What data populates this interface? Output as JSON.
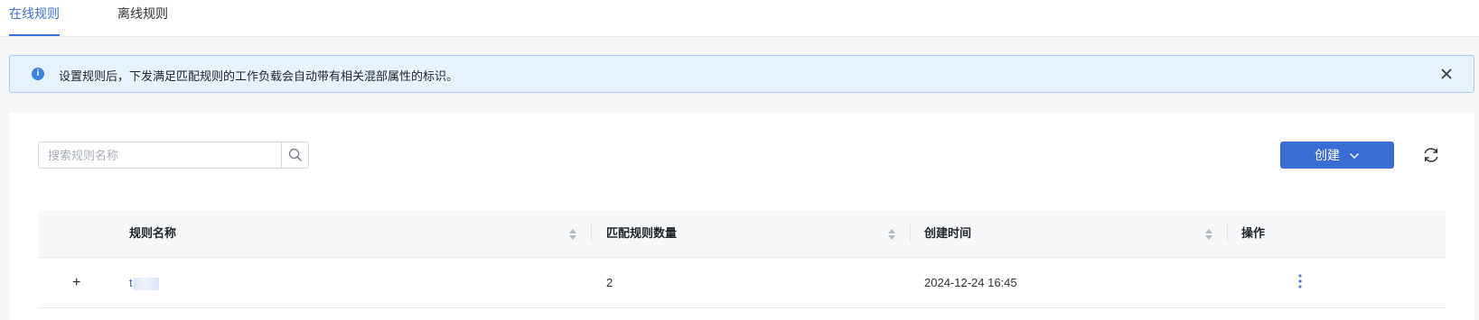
{
  "tabs": [
    {
      "label": "在线规则",
      "active": true
    },
    {
      "label": "离线规则",
      "active": false
    }
  ],
  "alert": {
    "message": "设置规则后，下发满足匹配规则的工作负载会自动带有相关混部属性的标识。",
    "icon": "info-icon"
  },
  "toolbar": {
    "search_placeholder": "搜索规则名称",
    "search_value": "",
    "create_label": "创建",
    "refresh_icon": "refresh-icon"
  },
  "table": {
    "columns": [
      "规则名称",
      "匹配规则数量",
      "创建时间",
      "操作"
    ],
    "rows": [
      {
        "name": "t",
        "match_count": "2",
        "created": "2024-12-24 16:45"
      }
    ]
  },
  "colors": {
    "accent": "#3a6dd4",
    "alert_bg": "#e6f3fd",
    "alert_border": "#a9cdf1"
  }
}
